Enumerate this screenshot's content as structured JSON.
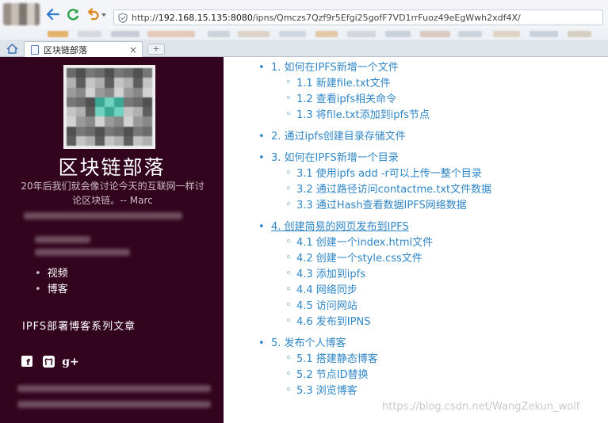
{
  "browser": {
    "url_prefix": "http://",
    "url_host": "192.168.15.135:8080",
    "url_path": "/ipns/Qmczs7Qzf9r5Efgi25gofF7VD1rrFuoz49eEgWwh2xdf4X/",
    "tab_title": "区块链部落",
    "tab_close": "×",
    "new_tab": "+",
    "bookmark_colors": [
      "#e3b26a",
      "#d6d9de",
      "#c7ced8",
      "#e5c9b9",
      "#ccd3dd",
      "#dbd2c9",
      "#cfd7e2",
      "#e3c7a9",
      "#d3d8df",
      "#c8d0da",
      "#d9c9bf",
      "#ccd4de",
      "#dfd3c6",
      "#c9d1dc",
      "#d6cdc3"
    ]
  },
  "sidebar": {
    "site_title": "区块链部落",
    "description": "20年后我们就会像讨论今天的互联网一样讨论区块链。-- Marc",
    "nav_items": [
      "视频",
      "博客"
    ],
    "series_title": "IPFS部署博客系列文章",
    "social_icons": [
      "facebook-icon",
      "github-icon",
      "google-plus-icon"
    ],
    "social_fb_letter": "f",
    "social_gp_text": "g+",
    "colors": {
      "background": "#33041d",
      "text": "#ffffff",
      "muted": "#cdbbc4"
    }
  },
  "toc": [
    {
      "label": "1. 如何在IPFS新增一个文件",
      "active": false,
      "children": [
        "1.1 新建file.txt文件",
        "1.2 查看ipfs相关命令",
        "1.3 将file.txt添加到ipfs节点"
      ]
    },
    {
      "label": "2. 通过ipfs创建目录存储文件",
      "active": false,
      "children": []
    },
    {
      "label": "3. 如何在IPFS新增一个目录",
      "active": false,
      "children": [
        "3.1 使用ipfs add -r可以上传一整个目录",
        "3.2 通过路径访问contactme.txt文件数据",
        "3.3 通过Hash查看数据IPFS网络数据"
      ]
    },
    {
      "label": "4. 创建简易的网页发布到IPFS",
      "active": true,
      "children": [
        "4.1 创建一个index.html文件",
        "4.2 创建一个style.css文件",
        "4.3 添加到ipfs",
        "4.4 网络同步",
        "4.5 访问网站",
        "4.6 发布到IPNS"
      ]
    },
    {
      "label": "5. 发布个人博客",
      "active": false,
      "children": [
        "5.1 搭建静态博客",
        "5.2 节点ID替换",
        "5.3 浏览博客"
      ]
    }
  ],
  "link_color": "#2f86c7",
  "watermark": "https://blog.csdn.net/WangZekun_wolf"
}
